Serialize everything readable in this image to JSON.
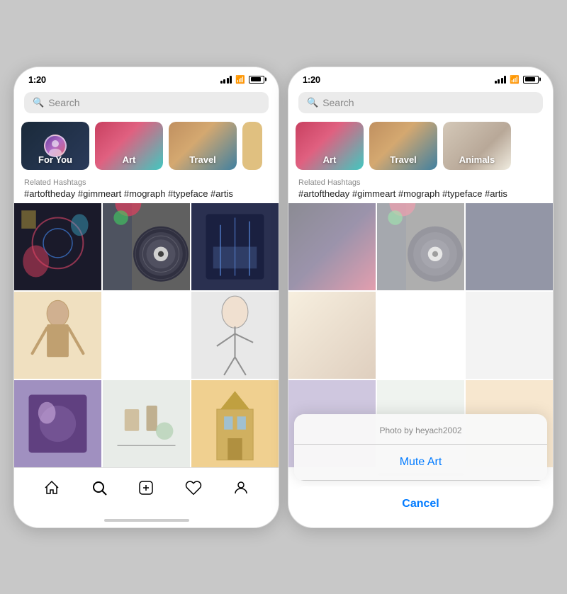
{
  "left_phone": {
    "status_bar": {
      "time": "1:20",
      "signal": true,
      "wifi": true,
      "battery": true
    },
    "search": {
      "placeholder": "Search"
    },
    "categories": [
      {
        "id": "for-you",
        "label": "For You",
        "has_avatar": true
      },
      {
        "id": "art",
        "label": "Art",
        "has_avatar": false
      },
      {
        "id": "travel",
        "label": "Travel",
        "has_avatar": false
      },
      {
        "id": "partial",
        "label": "",
        "has_avatar": false
      }
    ],
    "hashtags": {
      "section_label": "Related Hashtags",
      "tags": "#artoftheday #gimmeart #mograph #typeface #artis"
    },
    "grid_photos": [
      {
        "id": 1,
        "style_class": "art-grid-1"
      },
      {
        "id": 2,
        "style_class": "big-art",
        "tall": true
      },
      {
        "id": 3,
        "style_class": "art-grid-3"
      },
      {
        "id": 4,
        "style_class": "art-grid-4"
      },
      {
        "id": 5,
        "style_class": "art-grid-5"
      },
      {
        "id": 6,
        "style_class": "art-grid-6"
      },
      {
        "id": 7,
        "style_class": "art-grid-7"
      },
      {
        "id": 8,
        "style_class": "art-grid-8"
      },
      {
        "id": 9,
        "style_class": "art-grid-9"
      }
    ],
    "nav": {
      "items": [
        {
          "id": "home",
          "icon": "⌂",
          "active": false
        },
        {
          "id": "search",
          "icon": "⌕",
          "active": true
        },
        {
          "id": "add",
          "icon": "⊕",
          "active": false
        },
        {
          "id": "heart",
          "icon": "♡",
          "active": false
        },
        {
          "id": "profile",
          "icon": "◯",
          "active": false
        }
      ]
    }
  },
  "right_phone": {
    "status_bar": {
      "time": "1:20",
      "signal": true,
      "wifi": true,
      "battery": true
    },
    "search": {
      "placeholder": "Search"
    },
    "categories": [
      {
        "id": "art",
        "label": "Art",
        "has_avatar": false
      },
      {
        "id": "travel",
        "label": "Travel",
        "has_avatar": false
      },
      {
        "id": "animals",
        "label": "Animals",
        "has_avatar": false
      }
    ],
    "hashtags": {
      "section_label": "Related Hashtags",
      "tags": "#artoftheday #gimmeart #mograph #typeface #artis"
    },
    "action_sheet": {
      "header": "Photo by heyach2002",
      "primary_action": "Mute Art",
      "cancel_label": "Cancel"
    }
  }
}
